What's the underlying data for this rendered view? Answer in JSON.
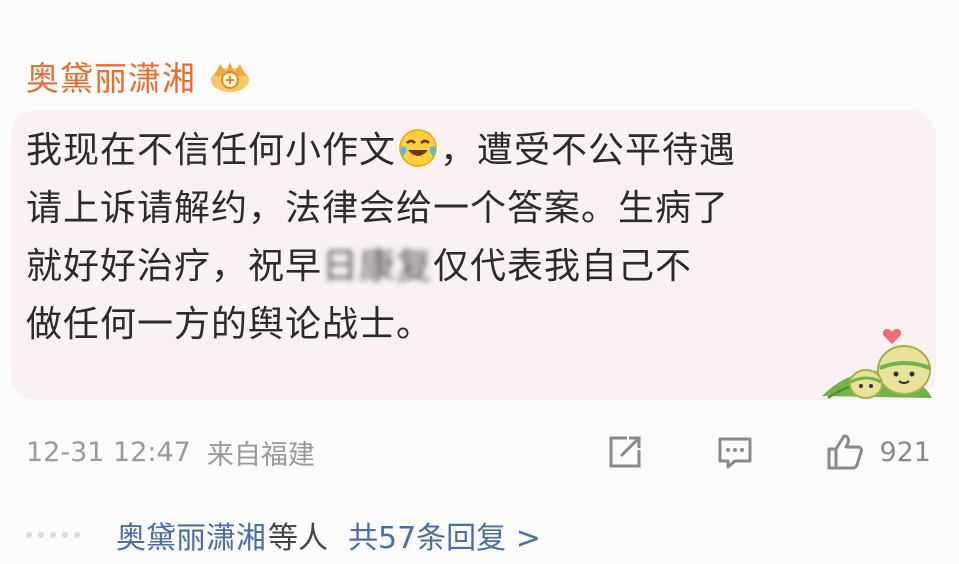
{
  "comment": {
    "username": "奥黛丽潇湘",
    "badge_icon": "vip-crown-badge-icon",
    "text_part1": "我现在不信任何小作文",
    "emoji_icon": "laughing-crying-emoji-icon",
    "text_part2": "，遭受不公平待遇\n请上诉请解约，法律会给一个答案。生病了\n就好好治疗，祝早",
    "text_blurred": "日康复",
    "text_part3": "仅代表我自己不\n做任何一方的舆论战士。",
    "decoration_icon": "rice-dumpling-sticker-icon",
    "timestamp": "12-31 12:47",
    "source": "来自福建",
    "like_count": "921"
  },
  "actions": {
    "share_icon": "share-icon",
    "comment_icon": "comment-icon",
    "like_icon": "thumbs-up-icon"
  },
  "replies": {
    "user": "奥黛丽潇湘",
    "others_suffix": "等人",
    "link": "共57条回复 >"
  },
  "colors": {
    "username": "#e86e2f",
    "link": "#4a6ea9",
    "bubble_bg": "#faf2f2",
    "meta": "#9a9a9a"
  }
}
